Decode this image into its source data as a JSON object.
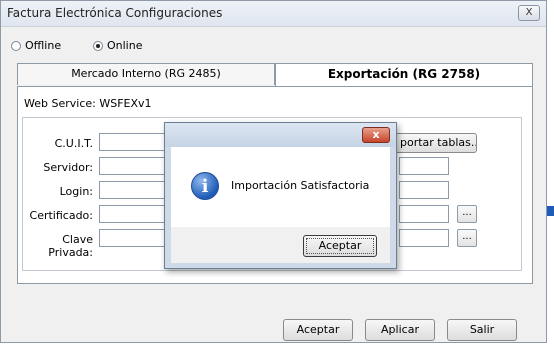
{
  "window": {
    "title": "Factura Electrónica Configuraciones",
    "close_label": "X"
  },
  "mode": {
    "offline_label": "Offline",
    "online_label": "Online",
    "selected": "Online"
  },
  "tabs": [
    {
      "label": "Mercado Interno (RG 2485)",
      "active": false
    },
    {
      "label": "Exportación (RG 2758)",
      "active": true
    }
  ],
  "panel": {
    "web_service": "Web Service: WSFEXv1",
    "fields": [
      {
        "label": "C.U.I.T.",
        "value": ""
      },
      {
        "label": "Servidor:",
        "value": ""
      },
      {
        "label": "Login:",
        "value": ""
      },
      {
        "label": "Certificado:",
        "value": ""
      },
      {
        "label": "Clave Privada:",
        "value": ""
      }
    ],
    "import_button": "portar tablas...",
    "browse_label": "..."
  },
  "dialog": {
    "close_label": "x",
    "message": "Importación Satisfactoria",
    "ok_button": "Aceptar"
  },
  "footer": {
    "accept": "Aceptar",
    "apply": "Aplicar",
    "exit": "Salir"
  },
  "colors": {
    "accent": "#1f5cb8",
    "close_red": "#c8442a",
    "window_bg": "#f0f0f0"
  }
}
